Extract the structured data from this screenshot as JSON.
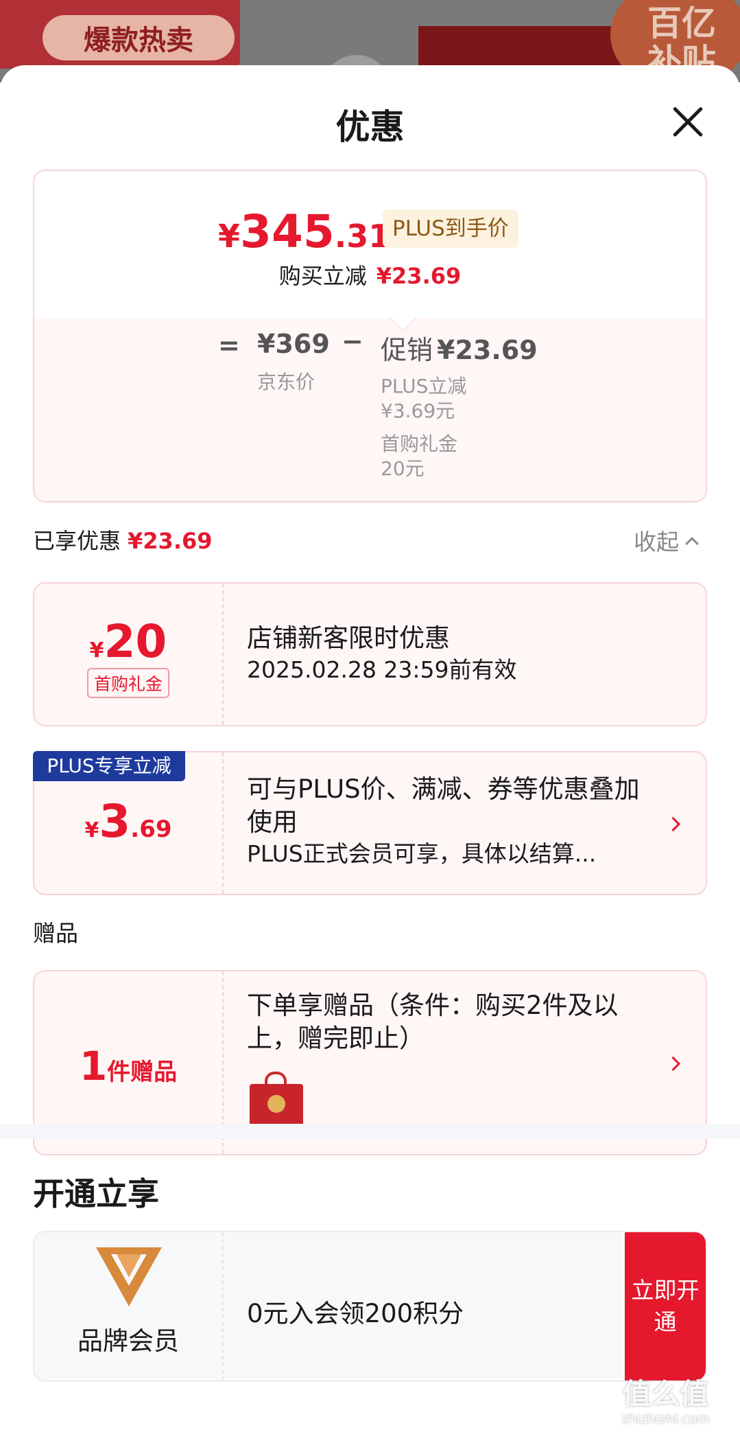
{
  "background": {
    "banner_pill": "爆款热卖",
    "badge_text": "百亿补贴"
  },
  "sheet": {
    "title": "优惠",
    "close_icon": "close-icon"
  },
  "price_summary": {
    "currency": "¥",
    "final_int": "345",
    "final_dec": ".31",
    "plus_tag": "PLUS到手价",
    "reduce_label": "购买立减",
    "reduce_value": "¥23.69",
    "equals": "=",
    "jd_price": "¥369",
    "jd_label": "京东价",
    "minus": "−",
    "promo_label": "促销",
    "promo_value": "¥23.69",
    "details": [
      "PLUS立减",
      "¥3.69元",
      "首购礼金",
      "20元"
    ]
  },
  "enjoyed": {
    "label": "已享优惠",
    "value": "¥23.69",
    "collapse_label": "收起"
  },
  "coupons": [
    {
      "currency": "¥",
      "amount_int": "20",
      "tag": "首购礼金",
      "title": "店铺新客限时优惠",
      "subtitle": "2025.02.28 23:59前有效"
    },
    {
      "badge": "PLUS专享立减",
      "currency": "¥",
      "amount_int": "3",
      "amount_dec": ".69",
      "title": "可与PLUS价、满减、券等优惠叠加使用",
      "subtitle": "PLUS正式会员可享，具体以结算..."
    }
  ],
  "gift_section": {
    "label": "赠品",
    "count": "1",
    "count_unit": "件赠品",
    "title": "下单享赠品（条件：购买2件及以上，赠完即止）",
    "image_icon": "gift-bag-icon"
  },
  "open_section": {
    "title": "开通立享",
    "member_name": "品牌会员",
    "offer": "0元入会领200积分",
    "button": "立即开通",
    "logo_icon": "brand-v-logo-icon"
  },
  "watermark": {
    "text": "值么值",
    "url": "zhizhizhi.com"
  },
  "colors": {
    "accent_red": "#e5182e",
    "plus_blue": "#1e3a9d",
    "plus_gold_bg": "#fdf2df"
  }
}
